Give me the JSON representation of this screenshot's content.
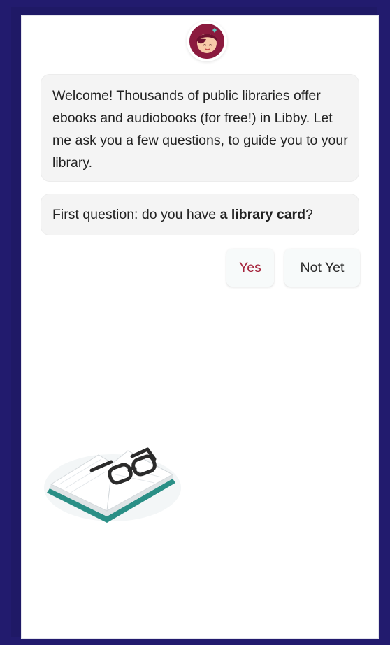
{
  "chat": {
    "welcome_text": "Welcome! Thousands of public libraries offer ebooks and audiobooks (for free!) in Libby. Let me ask you a few questions, to guide you to your library.",
    "question_prefix": "First question: do you have ",
    "question_bold": "a library card",
    "question_suffix": "?"
  },
  "actions": {
    "yes_label": "Yes",
    "not_yet_label": "Not Yet"
  },
  "icons": {
    "avatar": "libby-avatar-icon",
    "illustration": "book-with-glasses-icon"
  },
  "colors": {
    "frame": "#221b6e",
    "accent": "#a5243c",
    "avatar_bg": "#8b1a3e",
    "book_cover": "#2a8f86"
  }
}
